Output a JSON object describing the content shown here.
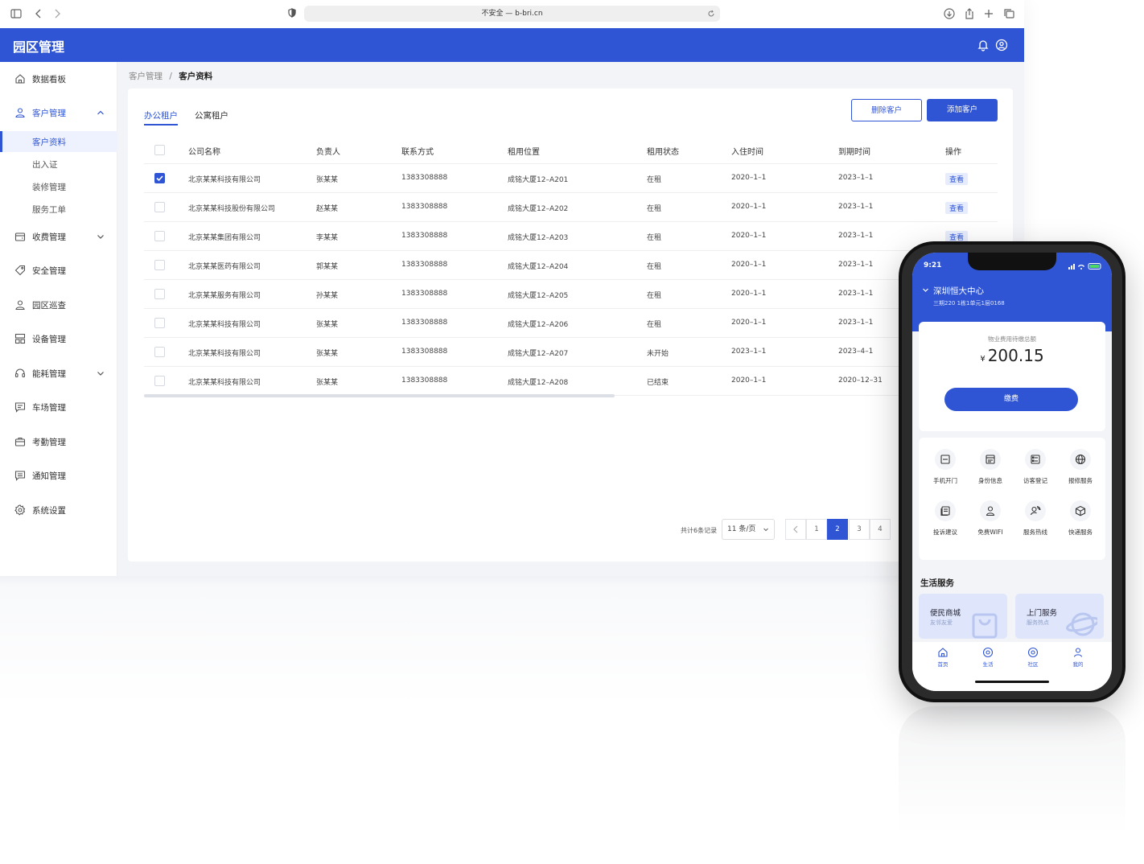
{
  "browser": {
    "url": "不安全 — b-bri.cn"
  },
  "app": {
    "title": "园区管理"
  },
  "sidebar": {
    "items": [
      {
        "label": "数据看板",
        "icon": "home-icon"
      },
      {
        "label": "客户管理",
        "icon": "user-icon",
        "expanded": true
      },
      {
        "label": "收费管理",
        "icon": "wallet-icon",
        "expandable": true
      },
      {
        "label": "安全管理",
        "icon": "tag-icon"
      },
      {
        "label": "园区巡查",
        "icon": "person-icon"
      },
      {
        "label": "设备管理",
        "icon": "device-icon"
      },
      {
        "label": "能耗管理",
        "icon": "headset-icon",
        "expandable": true
      },
      {
        "label": "车场管理",
        "icon": "message-icon"
      },
      {
        "label": "考勤管理",
        "icon": "briefcase-icon"
      },
      {
        "label": "通知管理",
        "icon": "notice-icon"
      },
      {
        "label": "系统设置",
        "icon": "gear-icon"
      }
    ],
    "sub_items": [
      "客户资料",
      "出入证",
      "装修管理",
      "服务工单"
    ],
    "active_sub": "客户资料"
  },
  "breadcrumb": {
    "parent": "客户管理",
    "separator": "/",
    "current": "客户资料"
  },
  "tabs": [
    {
      "label": "办公租户",
      "active": true
    },
    {
      "label": "公寓租户",
      "active": false
    }
  ],
  "actions": {
    "delete": "删除客户",
    "add": "添加客户"
  },
  "table": {
    "columns": [
      "公司名称",
      "负责人",
      "联系方式",
      "租用位置",
      "租用状态",
      "入住时间",
      "到期时间",
      "操作"
    ],
    "rows": [
      {
        "checked": true,
        "company": "北京某某科技有限公司",
        "owner": "张某某",
        "phone": "1383308888",
        "location": "成铭大厦12–A201",
        "status": "在租",
        "start": "2020–1–1",
        "end": "2023–1–1",
        "action": "查看"
      },
      {
        "checked": false,
        "company": "北京某某科技股份有限公司",
        "owner": "赵某某",
        "phone": "1383308888",
        "location": "成铭大厦12–A202",
        "status": "在租",
        "start": "2020–1–1",
        "end": "2023–1–1",
        "action": "查看"
      },
      {
        "checked": false,
        "company": "北京某某集团有限公司",
        "owner": "李某某",
        "phone": "1383308888",
        "location": "成铭大厦12–A203",
        "status": "在租",
        "start": "2020–1–1",
        "end": "2023–1–1",
        "action": "查看"
      },
      {
        "checked": false,
        "company": "北京某某医药有限公司",
        "owner": "郭某某",
        "phone": "1383308888",
        "location": "成铭大厦12–A204",
        "status": "在租",
        "start": "2020–1–1",
        "end": "2023–1–1",
        "action": ""
      },
      {
        "checked": false,
        "company": "北京某某服务有限公司",
        "owner": "孙某某",
        "phone": "1383308888",
        "location": "成铭大厦12–A205",
        "status": "在租",
        "start": "2020–1–1",
        "end": "2023–1–1",
        "action": ""
      },
      {
        "checked": false,
        "company": "北京某某科技有限公司",
        "owner": "张某某",
        "phone": "1383308888",
        "location": "成铭大厦12–A206",
        "status": "在租",
        "start": "2020–1–1",
        "end": "2023–1–1",
        "action": ""
      },
      {
        "checked": false,
        "company": "北京某某科技有限公司",
        "owner": "张某某",
        "phone": "1383308888",
        "location": "成铭大厦12–A207",
        "status": "未开始",
        "start": "2023–1–1",
        "end": "2023–4–1",
        "action": ""
      },
      {
        "checked": false,
        "company": "北京某某科技有限公司",
        "owner": "张某某",
        "phone": "1383308888",
        "location": "成铭大厦12–A208",
        "status": "已结束",
        "start": "2020–1–1",
        "end": "2020–12–31",
        "action": ""
      }
    ]
  },
  "pagination": {
    "total": "共计6条记录",
    "page_size": "11 条/页",
    "pages": [
      "1",
      "2",
      "3",
      "4"
    ],
    "current": "2"
  },
  "phone": {
    "time": "9:21",
    "location": "深圳恒大中心",
    "address": "三期220 1栋1单元1层0168",
    "due_label": "物业费用待缴总额",
    "currency": "¥",
    "amount": "200.15",
    "pay_button": "缴费",
    "services": [
      {
        "label": "手机开门",
        "icon": "door-icon"
      },
      {
        "label": "身份信息",
        "icon": "id-card-icon"
      },
      {
        "label": "访客登记",
        "icon": "register-icon"
      },
      {
        "label": "报修服务",
        "icon": "globe-icon"
      },
      {
        "label": "投诉建议",
        "icon": "document-icon"
      },
      {
        "label": "免费WIFI",
        "icon": "person-icon"
      },
      {
        "label": "服务热线",
        "icon": "hotline-icon"
      },
      {
        "label": "快递服务",
        "icon": "package-icon"
      }
    ],
    "life_title": "生活服务",
    "life_tiles": [
      {
        "title": "便民商城",
        "subtitle": "友邻友爱"
      },
      {
        "title": "上门服务",
        "subtitle": "服务热点"
      }
    ],
    "tabbar": [
      "首页",
      "生活",
      "社区",
      "我的"
    ]
  },
  "colors": {
    "primary": "#2f55d4",
    "background": "#f3f4f7"
  }
}
